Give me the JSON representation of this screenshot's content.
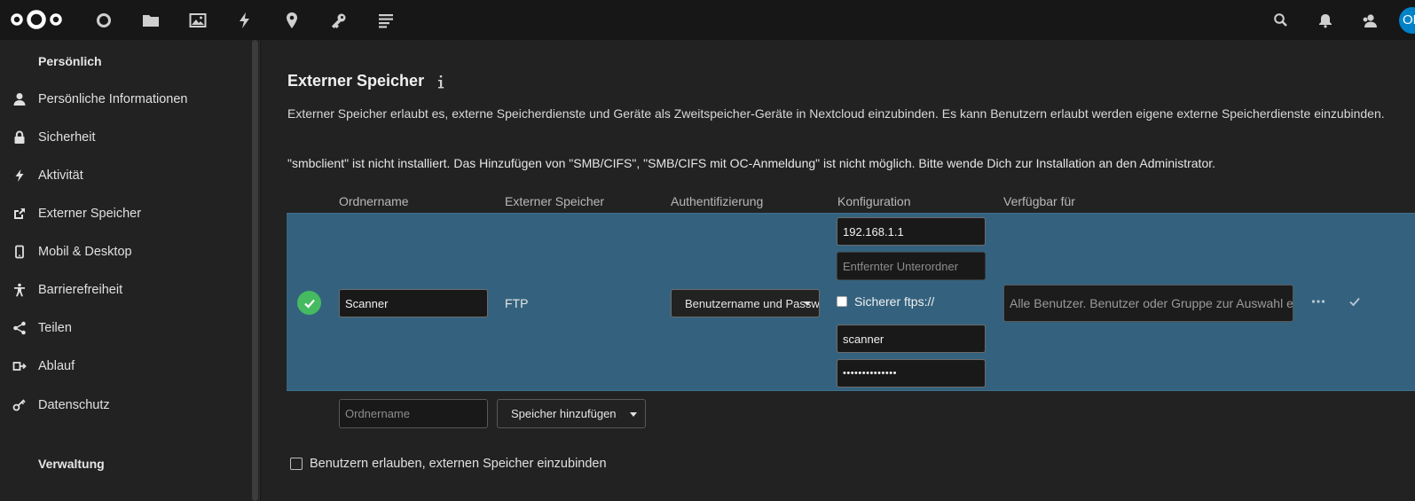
{
  "header": {
    "apps": [
      {
        "icon": "dashboard-icon"
      },
      {
        "icon": "files-icon"
      },
      {
        "icon": "photos-icon"
      },
      {
        "icon": "activity-icon"
      },
      {
        "icon": "maps-icon"
      },
      {
        "icon": "passwords-icon"
      },
      {
        "icon": "notes-icon"
      }
    ],
    "avatar_initials": "OL"
  },
  "sidebar": {
    "personal_heading": "Persönlich",
    "admin_heading": "Verwaltung",
    "items": [
      {
        "label": "Persönliche Informationen",
        "icon": "user-icon"
      },
      {
        "label": "Sicherheit",
        "icon": "lock-icon"
      },
      {
        "label": "Aktivität",
        "icon": "activity-icon"
      },
      {
        "label": "Externer Speicher",
        "icon": "external-storage-icon"
      },
      {
        "label": "Mobil & Desktop",
        "icon": "phone-icon"
      },
      {
        "label": "Barrierefreiheit",
        "icon": "accessibility-icon"
      },
      {
        "label": "Teilen",
        "icon": "share-icon"
      },
      {
        "label": "Ablauf",
        "icon": "flow-icon"
      },
      {
        "label": "Datenschutz",
        "icon": "key-icon"
      }
    ]
  },
  "main": {
    "title": "Externer Speicher",
    "description": "Externer Speicher erlaubt es, externe Speicherdienste und Geräte als Zweitspeicher-Geräte in Nextcloud einzubinden. Es kann Benutzern erlaubt werden eigene externe Speicherdienste einzubinden.",
    "warning": "\"smbclient\" ist nicht installiert. Das Hinzufügen von \"SMB/CIFS\", \"SMB/CIFS mit OC-Anmeldung\" ist nicht möglich. Bitte wende Dich zur Installation an den Administrator.",
    "columns": [
      "Ordnername",
      "Externer Speicher",
      "Authentifizierung",
      "Konfiguration",
      "Verfügbar für"
    ],
    "mount": {
      "folder_name": "Scanner",
      "backend": "FTP",
      "auth": "Benutzername und Passwort",
      "host": "192.168.1.1",
      "remote_subfolder_placeholder": "Entfernter Unterordner",
      "secure_label": "Sicherer ftps://",
      "username": "scanner",
      "password": "••••••••••••••",
      "applicable_placeholder": "Alle Benutzer. Benutzer oder Gruppe zur Auswahl eingeben."
    },
    "new_mount": {
      "folder_placeholder": "Ordnername",
      "add_storage_label": "Speicher hinzufügen"
    },
    "allow_user_mounting_label": "Benutzern erlauben, externen Speicher einzubinden"
  },
  "colors": {
    "accent": "#0082c9",
    "row_bg": "#34627e",
    "success": "#46ba61"
  }
}
